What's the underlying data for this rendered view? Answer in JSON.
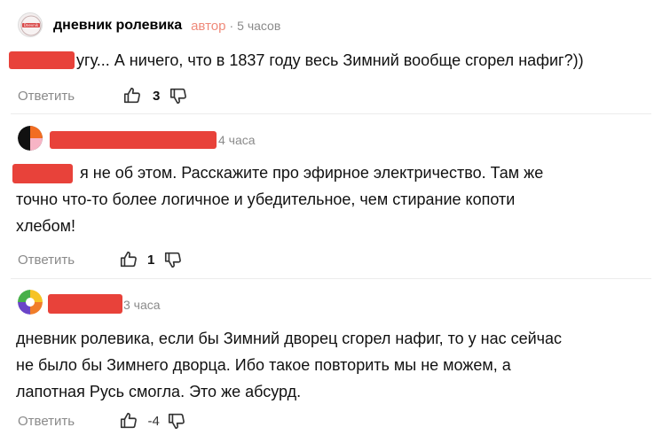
{
  "comments": [
    {
      "author": "дневник ролевика",
      "badge": "автор",
      "time": "5 часов",
      "avatar_seal_text": "Dnevnik",
      "text_line_1": "угу... А ничего, что в 1837 году весь Зимний вообще сгорел нафиг?))",
      "reply_label": "Ответить",
      "likes": "3"
    },
    {
      "time": "4 часа",
      "text_line_1": "я не об этом. Расскажите про эфирное электричество. Там же",
      "text_line_2": "точно что-то более логичное и убедительное, чем стирание копоти",
      "text_line_3": "хлебом!",
      "reply_label": "Ответить",
      "likes": "1"
    },
    {
      "time": "3 часа",
      "text_line_1": "дневник ролевика, если бы Зимний дворец сгорел нафиг, то у нас сейчас",
      "text_line_2": "не было бы Зимнего дворца. Ибо такое повторить мы не можем, а",
      "text_line_3": "лапотная Русь смогла. Это же абсурд.",
      "reply_label": "Ответить",
      "likes": "-4"
    }
  ],
  "icons": {
    "like": "thumbs-up-outline-icon",
    "dislike": "thumbs-down-outline-icon"
  },
  "colors": {
    "redaction": "#e8423a",
    "badge": "#ef8a7a",
    "muted": "#8a8a8a"
  }
}
